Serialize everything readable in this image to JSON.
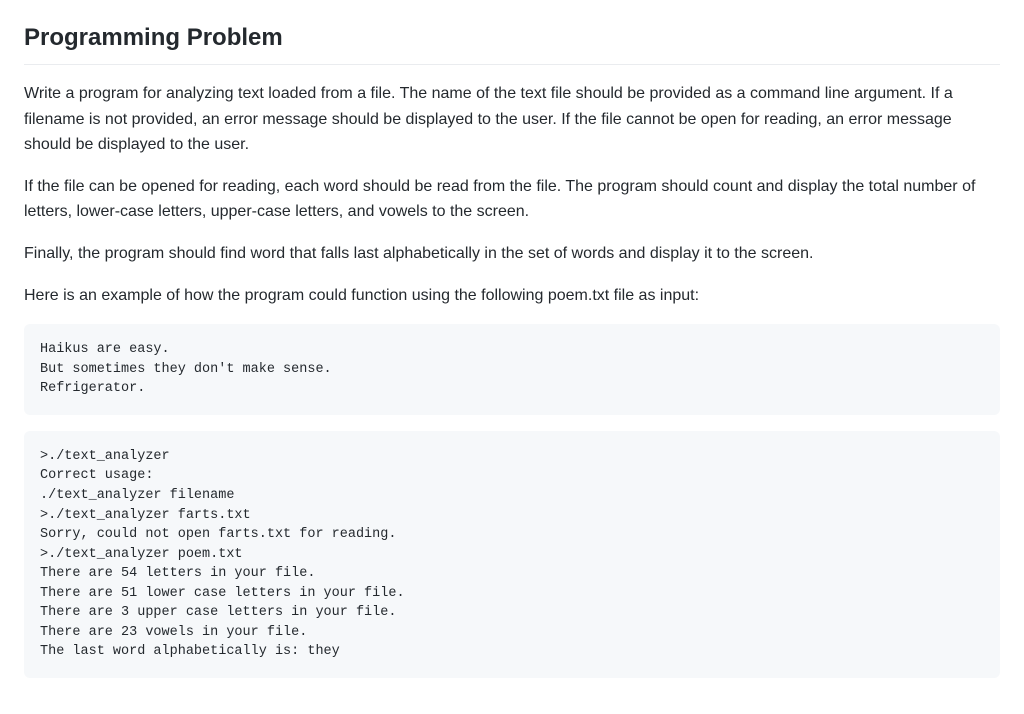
{
  "heading": "Programming Problem",
  "paragraphs": {
    "p1": "Write a program for analyzing text loaded from a file. The name of the text file should be provided as a command line argument. If a filename is not provided, an error message should be displayed to the user. If the file cannot be open for reading, an error message should be displayed to the user.",
    "p2": "If the file can be opened for reading, each word should be read from the file. The program should count and display the total number of letters, lower-case letters, upper-case letters, and vowels to the screen.",
    "p3": "Finally, the program should find word that falls last alphabetically in the set of words and display it to the screen.",
    "p4": "Here is an example of how the program could function using the following poem.txt file as input:"
  },
  "code_block_1": "Haikus are easy.\nBut sometimes they don't make sense.\nRefrigerator.",
  "code_block_2": ">./text_analyzer\nCorrect usage:\n./text_analyzer filename\n>./text_analyzer farts.txt\nSorry, could not open farts.txt for reading.\n>./text_analyzer poem.txt\nThere are 54 letters in your file.\nThere are 51 lower case letters in your file.\nThere are 3 upper case letters in your file.\nThere are 23 vowels in your file.\nThe last word alphabetically is: they"
}
